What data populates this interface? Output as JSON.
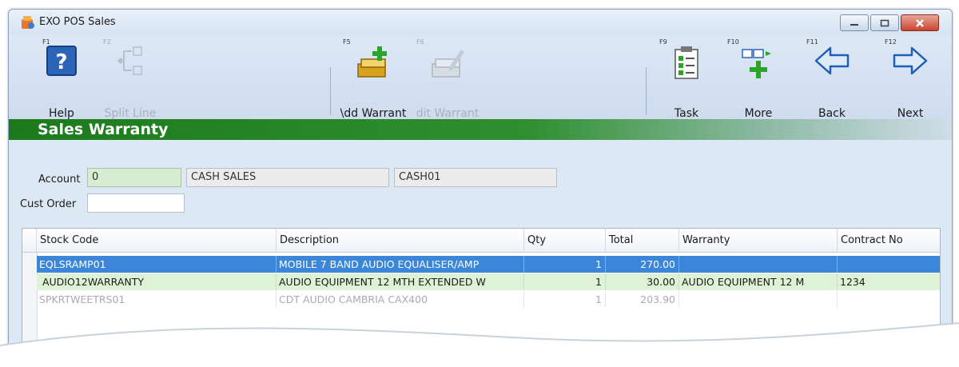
{
  "window": {
    "title": "EXO POS Sales"
  },
  "toolbar": {
    "buttons": [
      {
        "key": "F1",
        "label": "Help",
        "icon": "help-icon"
      },
      {
        "key": "F2",
        "label": "Split Line",
        "icon": "split-line-icon"
      },
      {
        "key": "F5",
        "label": "\\dd Warrant",
        "icon": "add-warranty-icon"
      },
      {
        "key": "F6",
        "label": "dit Warrant",
        "icon": "edit-warranty-icon"
      },
      {
        "key": "F9",
        "label": "Task",
        "icon": "task-checklist-icon"
      },
      {
        "key": "F10",
        "label": "More",
        "icon": "more-icon"
      },
      {
        "key": "F11",
        "label": "Back",
        "icon": "back-arrow-icon"
      },
      {
        "key": "F12",
        "label": "Next",
        "icon": "next-arrow-icon"
      }
    ]
  },
  "section": {
    "title": "Sales Warranty"
  },
  "form": {
    "account_label": "Account",
    "account_value": "0",
    "account_name": "CASH SALES",
    "account_code": "CASH01",
    "cust_order_label": "Cust Order",
    "cust_order_value": ""
  },
  "grid": {
    "columns": [
      "Stock Code",
      "Description",
      "Qty",
      "Total",
      "Warranty",
      "Contract No"
    ],
    "rows": [
      [
        "EQLSRAMP01",
        "MOBILE 7 BAND AUDIO EQUALISER/AMP",
        "1",
        "270.00",
        "",
        ""
      ],
      [
        " AUDIO12WARRANTY",
        "AUDIO EQUIPMENT 12 MTH EXTENDED W",
        "1",
        "30.00",
        "AUDIO EQUIPMENT 12 M",
        "1234"
      ],
      [
        "SPKRTWEETRS01",
        "CDT AUDIO CAMBRIA CAX400",
        "1",
        "203.90",
        "",
        ""
      ]
    ]
  },
  "colors": {
    "selected_row": "#3b86d9",
    "warranty_row": "#def3d6",
    "section_green": "#1c7a1c",
    "close_button": "#c8442f"
  }
}
